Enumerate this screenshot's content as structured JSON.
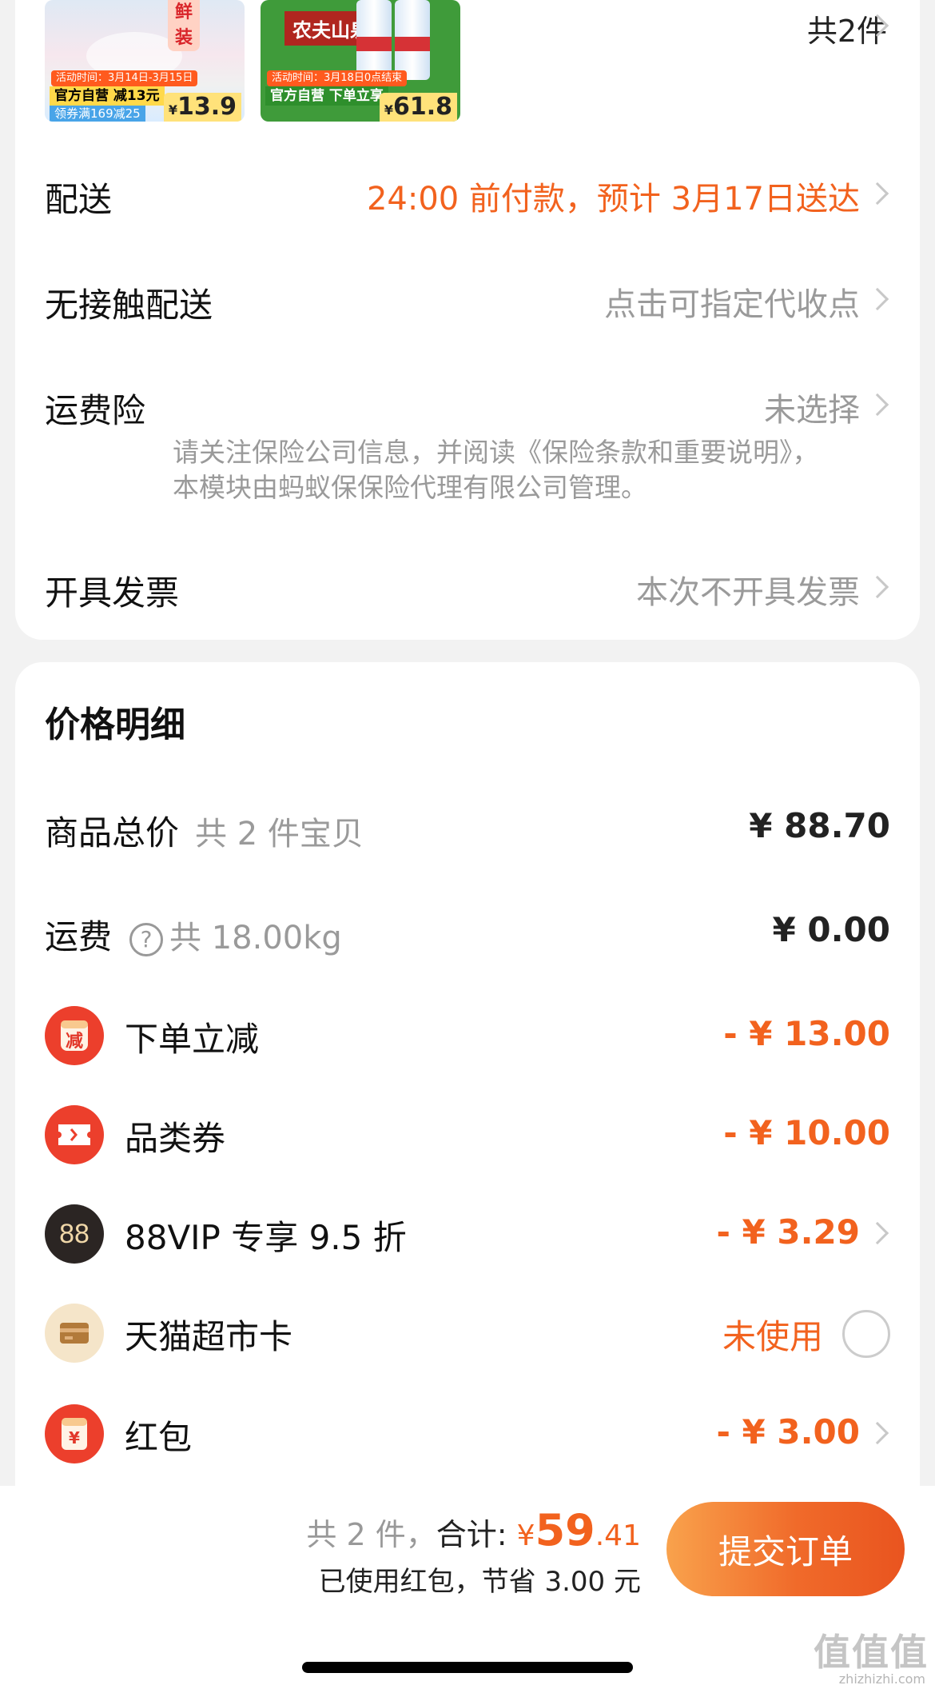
{
  "products": {
    "count_label": "共2件",
    "items": [
      {
        "promo": "活动时间：3月14日-3月15日",
        "tag": "官方自营 减13元",
        "coupon": "领券满169减25",
        "price": "13.9",
        "extra": "鲜装"
      },
      {
        "promo": "活动时间：3月18日0点结束",
        "tag": "官方自营  下单立享",
        "price": "61.8",
        "brand": "农夫山泉"
      }
    ],
    "price_yen": "¥"
  },
  "order_options": {
    "delivery": {
      "label": "配送",
      "value": "24:00 前付款，预计 3月17日送达"
    },
    "contactless": {
      "label": "无接触配送",
      "value": "点击可指定代收点"
    },
    "insurance": {
      "label": "运费险",
      "value": "未选择",
      "note": "请关注保险公司信息，并阅读《保险条款和重要说明》，本模块由蚂蚁保保险代理有限公司管理。"
    },
    "invoice": {
      "label": "开具发票",
      "value": "本次不开具发票"
    }
  },
  "price_detail": {
    "title": "价格明细",
    "goods_total": {
      "label": "商品总价",
      "sub": "共 2 件宝贝",
      "amount": "¥ 88.70"
    },
    "shipping": {
      "label": "运费",
      "sub": "共 18.00kg",
      "amount": "¥ 0.00",
      "help_glyph": "?"
    },
    "instant_discount": {
      "label": "下单立减",
      "amount": "- ¥ 13.00",
      "icon": "减"
    },
    "category_coupon": {
      "label": "品类券",
      "amount": "- ¥ 10.00"
    },
    "vip": {
      "label": "88VIP 专享 9.5 折",
      "amount": "- ¥ 3.29",
      "icon": "88"
    },
    "tmall_card": {
      "label": "天猫超市卡",
      "status": "未使用"
    },
    "red_packet": {
      "label": "红包",
      "amount": "- ¥ 3.00",
      "icon": "¥"
    }
  },
  "bottom_bar": {
    "count": "共 2 件，",
    "total_label": "合计:",
    "yen": "¥",
    "total_int": "59",
    "total_dec": ".41",
    "savings": "已使用红包，节省 3.00 元",
    "submit": "提交订单"
  },
  "watermark": {
    "text": "值值值",
    "url": "zhizhizhi.com"
  },
  "colors": {
    "accent": "#f2621e",
    "icon_red": "#ec3f2c",
    "muted": "#9a9a9a"
  }
}
